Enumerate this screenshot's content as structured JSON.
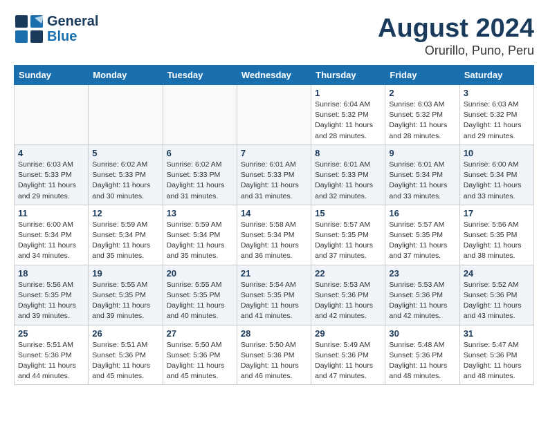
{
  "logo": {
    "general": "General",
    "blue": "Blue"
  },
  "header": {
    "month": "August 2024",
    "location": "Orurillo, Puno, Peru"
  },
  "weekdays": [
    "Sunday",
    "Monday",
    "Tuesday",
    "Wednesday",
    "Thursday",
    "Friday",
    "Saturday"
  ],
  "weeks": [
    [
      {
        "day": "",
        "info": ""
      },
      {
        "day": "",
        "info": ""
      },
      {
        "day": "",
        "info": ""
      },
      {
        "day": "",
        "info": ""
      },
      {
        "day": "1",
        "info": "Sunrise: 6:04 AM\nSunset: 5:32 PM\nDaylight: 11 hours\nand 28 minutes."
      },
      {
        "day": "2",
        "info": "Sunrise: 6:03 AM\nSunset: 5:32 PM\nDaylight: 11 hours\nand 28 minutes."
      },
      {
        "day": "3",
        "info": "Sunrise: 6:03 AM\nSunset: 5:32 PM\nDaylight: 11 hours\nand 29 minutes."
      }
    ],
    [
      {
        "day": "4",
        "info": "Sunrise: 6:03 AM\nSunset: 5:33 PM\nDaylight: 11 hours\nand 29 minutes."
      },
      {
        "day": "5",
        "info": "Sunrise: 6:02 AM\nSunset: 5:33 PM\nDaylight: 11 hours\nand 30 minutes."
      },
      {
        "day": "6",
        "info": "Sunrise: 6:02 AM\nSunset: 5:33 PM\nDaylight: 11 hours\nand 31 minutes."
      },
      {
        "day": "7",
        "info": "Sunrise: 6:01 AM\nSunset: 5:33 PM\nDaylight: 11 hours\nand 31 minutes."
      },
      {
        "day": "8",
        "info": "Sunrise: 6:01 AM\nSunset: 5:33 PM\nDaylight: 11 hours\nand 32 minutes."
      },
      {
        "day": "9",
        "info": "Sunrise: 6:01 AM\nSunset: 5:34 PM\nDaylight: 11 hours\nand 33 minutes."
      },
      {
        "day": "10",
        "info": "Sunrise: 6:00 AM\nSunset: 5:34 PM\nDaylight: 11 hours\nand 33 minutes."
      }
    ],
    [
      {
        "day": "11",
        "info": "Sunrise: 6:00 AM\nSunset: 5:34 PM\nDaylight: 11 hours\nand 34 minutes."
      },
      {
        "day": "12",
        "info": "Sunrise: 5:59 AM\nSunset: 5:34 PM\nDaylight: 11 hours\nand 35 minutes."
      },
      {
        "day": "13",
        "info": "Sunrise: 5:59 AM\nSunset: 5:34 PM\nDaylight: 11 hours\nand 35 minutes."
      },
      {
        "day": "14",
        "info": "Sunrise: 5:58 AM\nSunset: 5:34 PM\nDaylight: 11 hours\nand 36 minutes."
      },
      {
        "day": "15",
        "info": "Sunrise: 5:57 AM\nSunset: 5:35 PM\nDaylight: 11 hours\nand 37 minutes."
      },
      {
        "day": "16",
        "info": "Sunrise: 5:57 AM\nSunset: 5:35 PM\nDaylight: 11 hours\nand 37 minutes."
      },
      {
        "day": "17",
        "info": "Sunrise: 5:56 AM\nSunset: 5:35 PM\nDaylight: 11 hours\nand 38 minutes."
      }
    ],
    [
      {
        "day": "18",
        "info": "Sunrise: 5:56 AM\nSunset: 5:35 PM\nDaylight: 11 hours\nand 39 minutes."
      },
      {
        "day": "19",
        "info": "Sunrise: 5:55 AM\nSunset: 5:35 PM\nDaylight: 11 hours\nand 39 minutes."
      },
      {
        "day": "20",
        "info": "Sunrise: 5:55 AM\nSunset: 5:35 PM\nDaylight: 11 hours\nand 40 minutes."
      },
      {
        "day": "21",
        "info": "Sunrise: 5:54 AM\nSunset: 5:35 PM\nDaylight: 11 hours\nand 41 minutes."
      },
      {
        "day": "22",
        "info": "Sunrise: 5:53 AM\nSunset: 5:36 PM\nDaylight: 11 hours\nand 42 minutes."
      },
      {
        "day": "23",
        "info": "Sunrise: 5:53 AM\nSunset: 5:36 PM\nDaylight: 11 hours\nand 42 minutes."
      },
      {
        "day": "24",
        "info": "Sunrise: 5:52 AM\nSunset: 5:36 PM\nDaylight: 11 hours\nand 43 minutes."
      }
    ],
    [
      {
        "day": "25",
        "info": "Sunrise: 5:51 AM\nSunset: 5:36 PM\nDaylight: 11 hours\nand 44 minutes."
      },
      {
        "day": "26",
        "info": "Sunrise: 5:51 AM\nSunset: 5:36 PM\nDaylight: 11 hours\nand 45 minutes."
      },
      {
        "day": "27",
        "info": "Sunrise: 5:50 AM\nSunset: 5:36 PM\nDaylight: 11 hours\nand 45 minutes."
      },
      {
        "day": "28",
        "info": "Sunrise: 5:50 AM\nSunset: 5:36 PM\nDaylight: 11 hours\nand 46 minutes."
      },
      {
        "day": "29",
        "info": "Sunrise: 5:49 AM\nSunset: 5:36 PM\nDaylight: 11 hours\nand 47 minutes."
      },
      {
        "day": "30",
        "info": "Sunrise: 5:48 AM\nSunset: 5:36 PM\nDaylight: 11 hours\nand 48 minutes."
      },
      {
        "day": "31",
        "info": "Sunrise: 5:47 AM\nSunset: 5:36 PM\nDaylight: 11 hours\nand 48 minutes."
      }
    ]
  ]
}
